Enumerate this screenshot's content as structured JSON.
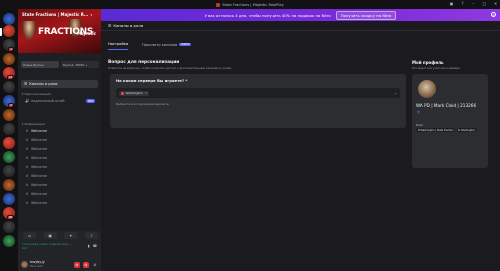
{
  "window": {
    "title": "State Fractions | Majestic RolePlay",
    "controls": [
      "inbox-icon",
      "help-icon",
      "minimize",
      "maximize",
      "close"
    ]
  },
  "banner": {
    "text": "У вас осталось 4 дня, чтобы получить 40% на подарок на Nitro",
    "cta": "Получить скидку на Nitro"
  },
  "server": {
    "name": "State Fractions | Majestic R...",
    "banner_title": "FRACTIONS",
    "banner_logo": "Majestic"
  },
  "sidebar": {
    "tags": [
      "Новые Братья",
      "Братья: 38030 +"
    ],
    "roles_item": "Каналы и роли",
    "categories": [
      {
        "label": "Пресонализация"
      },
      {
        "label": "Информация"
      }
    ],
    "channels_top": [
      {
        "name": "подпольный штаб",
        "badge": "NEW",
        "icon": "voice"
      }
    ],
    "channels": [
      {
        "name": "Welcome"
      },
      {
        "name": "Welcome",
        "icon": "voice"
      },
      {
        "name": "Welcome",
        "icon": "voice"
      },
      {
        "name": "Welcome"
      },
      {
        "name": "Welcome"
      },
      {
        "name": "Welcome"
      },
      {
        "name": "Welcome"
      },
      {
        "name": "Welcome"
      },
      {
        "name": "Welcome"
      }
    ],
    "channel_labels": [
      "Welcome",
      "Welcome",
      "Welcome",
      "Welcome",
      "Welcome",
      "Welcome",
      "Welcome",
      "Welcome",
      "Welcome"
    ]
  },
  "voice_panel": {
    "status": "Голосовая связь подключена ...",
    "status2": "bot",
    "user_name": "mayby.jy",
    "user_status": "Не в сети"
  },
  "main": {
    "header": "Каналы и роли",
    "tabs": [
      {
        "label": "Настройка",
        "active": true
      },
      {
        "label": "Просмотр каналов",
        "badge": "НОВОЕ"
      }
    ],
    "question_title": "Вопрос для персонализации",
    "question_sub": "Ответьте на вопросы, чтобы получить доступ к дополнительным каналам и ролям.",
    "card": {
      "label": "На каком сервере Вы играете? *",
      "selected": "Washington",
      "hint": "Выберите все подходящие варианты"
    }
  },
  "profile": {
    "heading": "Мой профиль",
    "sub": "Это видят все участники сервера",
    "name": "WA PD | Mark Cloid | 213266",
    "roles_label": "Роли",
    "roles": [
      "Washington | State Fraction",
      "Washington"
    ]
  },
  "colors": {
    "accent": "#5865f2",
    "banner_from": "#5b2ad4",
    "banner_to": "#8e3ae0",
    "danger": "#da373c",
    "online": "#23a55a",
    "server_banner": "#a4161a"
  }
}
